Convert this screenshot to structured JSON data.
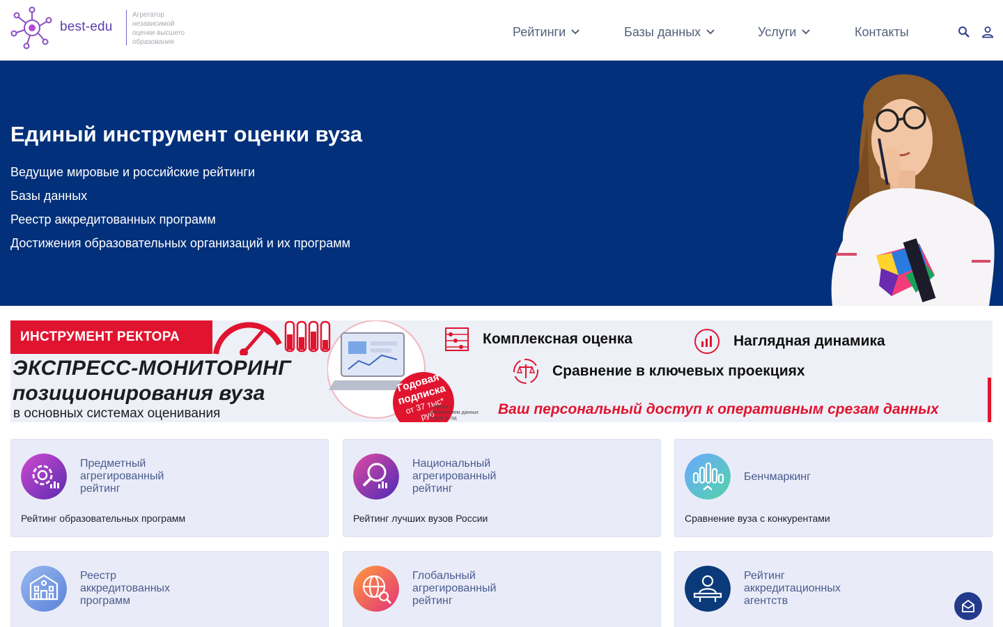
{
  "header": {
    "brand": "best-edu",
    "tagline": "Агрегатор независимой оценки высшего образования",
    "nav": [
      {
        "label": "Рейтинги",
        "dropdown": true
      },
      {
        "label": "Базы данных",
        "dropdown": true
      },
      {
        "label": "Услуги",
        "dropdown": true
      },
      {
        "label": "Контакты",
        "dropdown": false
      }
    ],
    "icons": [
      "search-icon",
      "user-icon"
    ]
  },
  "hero": {
    "title": "Единый инструмент оценки вуза",
    "items": [
      "Ведущие мировые и российские рейтинги",
      "Базы данных",
      "Реестр аккредитованных программ",
      "Достижения образовательных организаций и их программ"
    ]
  },
  "banner": {
    "tag": "ИНСТРУМЕНТ РЕКТОРА",
    "headline_1": "ЭКСПРЕСС-МОНИТОРИНГ",
    "headline_2": "позиционирования вуза",
    "headline_3": "в основных системах оценивания",
    "badge_1": "Годовая",
    "badge_2": "подписка",
    "badge_3": "от 37 тыс*",
    "badge_4": "руб",
    "footnote": "* Запуск с обновлением данных 4 раза в год",
    "features": [
      "Комплексная оценка",
      "Наглядная динамика",
      "Сравнение в ключевых проекциях"
    ],
    "access": "Ваш персональный доступ к оперативным срезам данных",
    "colors": {
      "accent": "#e0142f",
      "background": "#eef0f7"
    }
  },
  "cards": [
    {
      "title": "Предметный агрегированный рейтинг",
      "description": "Рейтинг образовательных программ",
      "icon": "gear-chart-icon"
    },
    {
      "title": "Национальный агрегированный рейтинг",
      "description": "Рейтинг лучших вузов России",
      "icon": "magnifier-chart-icon"
    },
    {
      "title": "Бенчмаркинг",
      "description": "Сравнение вуза с конкурентами",
      "icon": "bar-chart-icon"
    },
    {
      "title": "Реестр аккредитованных программ",
      "description": "",
      "icon": "building-icon"
    },
    {
      "title": "Глобальный агрегированный рейтинг",
      "description": "",
      "icon": "globe-search-icon"
    },
    {
      "title": "Рейтинг аккредитационных агентств",
      "description": "",
      "icon": "presenter-icon"
    }
  ],
  "fab": {
    "icon": "mail-icon"
  },
  "colors": {
    "hero_bg": "#02307a",
    "brand": "#5a3fb0",
    "card_bg": "#e9ecf8",
    "card_title": "#4a5a8e"
  }
}
